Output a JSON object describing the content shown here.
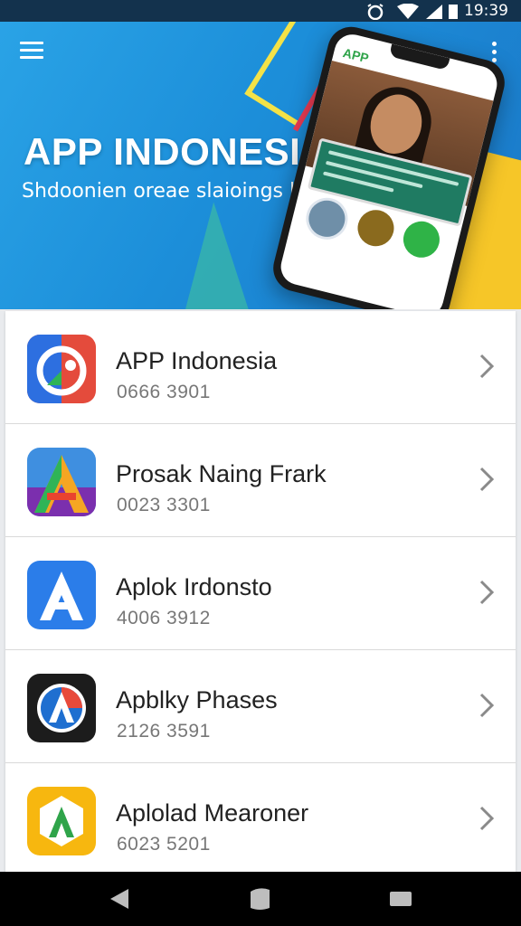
{
  "status_bar": {
    "time": "19:39"
  },
  "hero": {
    "title": "APP INDONESIA",
    "subtitle": "Shdoonien oreae slaioings labi",
    "phone_app_label": "APP"
  },
  "apps": [
    {
      "name": "APP Indonesia",
      "number": "0666 3901",
      "icon": "analytics-icon"
    },
    {
      "name": "Prosak Naing Frark",
      "number": "0023 3301",
      "icon": "triangle-a-icon"
    },
    {
      "name": "Aplok Irdonsto",
      "number": "4006 3912",
      "icon": "letter-a-icon"
    },
    {
      "name": "Apblky Phases",
      "number": "2126 3591",
      "icon": "circle-a-icon"
    },
    {
      "name": "Aplolad Mearoner",
      "number": "6023 5201",
      "icon": "hexagon-a-icon"
    }
  ],
  "colors": {
    "hero_bg": "#1c8ed9",
    "status_bg": "#13324d",
    "nav_bg": "#000000"
  }
}
